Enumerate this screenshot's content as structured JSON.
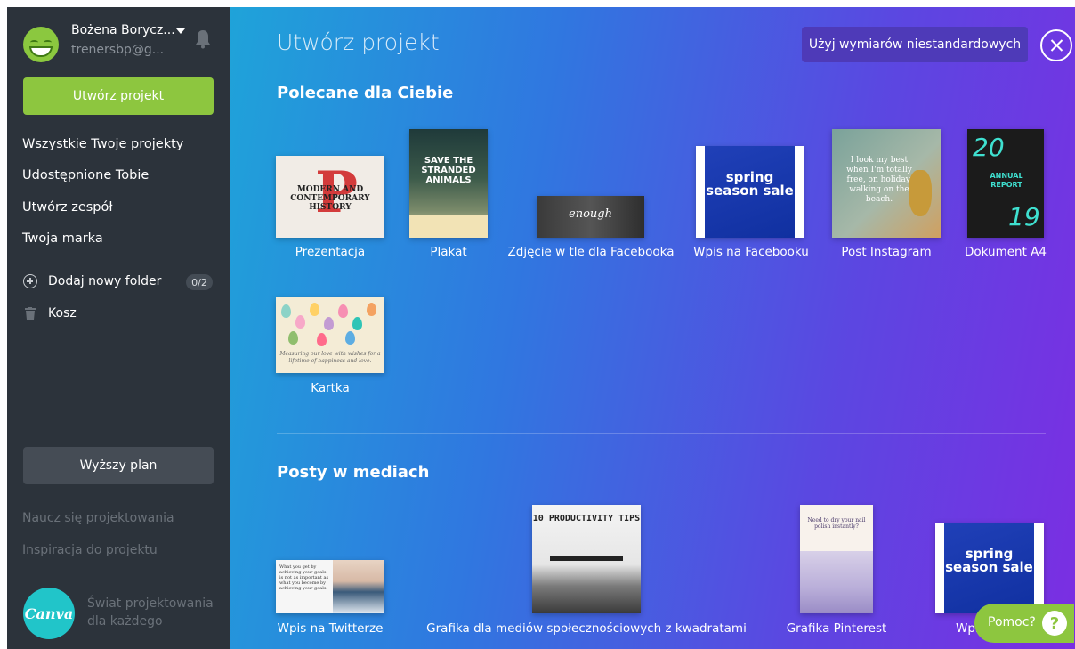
{
  "sidebar": {
    "user_name": "Bożena Borycz...",
    "user_email": "trenersbp@g...",
    "create_label": "Utwórz projekt",
    "nav": [
      "Wszystkie Twoje projekty",
      "Udostępnione Tobie",
      "Utwórz zespół",
      "Twoja marka"
    ],
    "add_folder_label": "Dodaj nowy folder",
    "folder_count": "0/2",
    "trash_label": "Kosz",
    "upgrade_label": "Wyższy plan",
    "learn_link": "Naucz się projektowania",
    "inspiration_link": "Inspiracja do projektu",
    "logo_text": "Canva",
    "tagline": "Świat projektowania dla każdego"
  },
  "main": {
    "title": "Utwórz projekt",
    "custom_dims_label": "Użyj wymiarów niestandardowych",
    "recommended": {
      "title": "Polecane dla Ciebie",
      "items": [
        "Prezentacja",
        "Plakat",
        "Zdjęcie w tle dla Facebooka",
        "Wpis na Facebooku",
        "Post Instagram",
        "Dokument A4",
        "Kartka"
      ]
    },
    "social": {
      "title": "Posty w mediach",
      "items": [
        "Wpis na Twitterze",
        "Grafika dla mediów społecznościowych z kwadratami",
        "Grafika Pinterest",
        "Wpis na"
      ]
    }
  },
  "thumbs": {
    "pres_text": "MODERN AND CONTEMPORARY HISTORY",
    "pres_letter": "P",
    "plakat_text": "SAVE THE STRANDED ANIMALS",
    "fb_text": "enough",
    "spring_text": "spring season sale",
    "insta_text": "I look my best when I'm totally free, on holiday, walking on the beach.",
    "a4_top": "20",
    "a4_bottom": "19",
    "a4_text": "ANNUAL REPORT",
    "kartka_text": "Measuring our love with wishes for a lifetime of happiness and love.",
    "tw_text": "What you get by achieving your goals is not as important as what you become by achieving your goals.",
    "prod_text": "10 PRODUCTIVITY TIPS",
    "pin_text": "Need to dry your nail polish instantly?"
  },
  "help": {
    "label": "Pomoc?",
    "icon": "?"
  },
  "colors": {
    "sidebar": "#2c333b",
    "green": "#8dc63f",
    "accent_purple": "#4e3ab8",
    "gradient_start": "#1fa3d9",
    "gradient_end": "#7b2ee2"
  },
  "icons": [
    "caret-down-icon",
    "bell-icon",
    "plus-circle-icon",
    "trash-icon",
    "close-icon",
    "help-icon"
  ]
}
